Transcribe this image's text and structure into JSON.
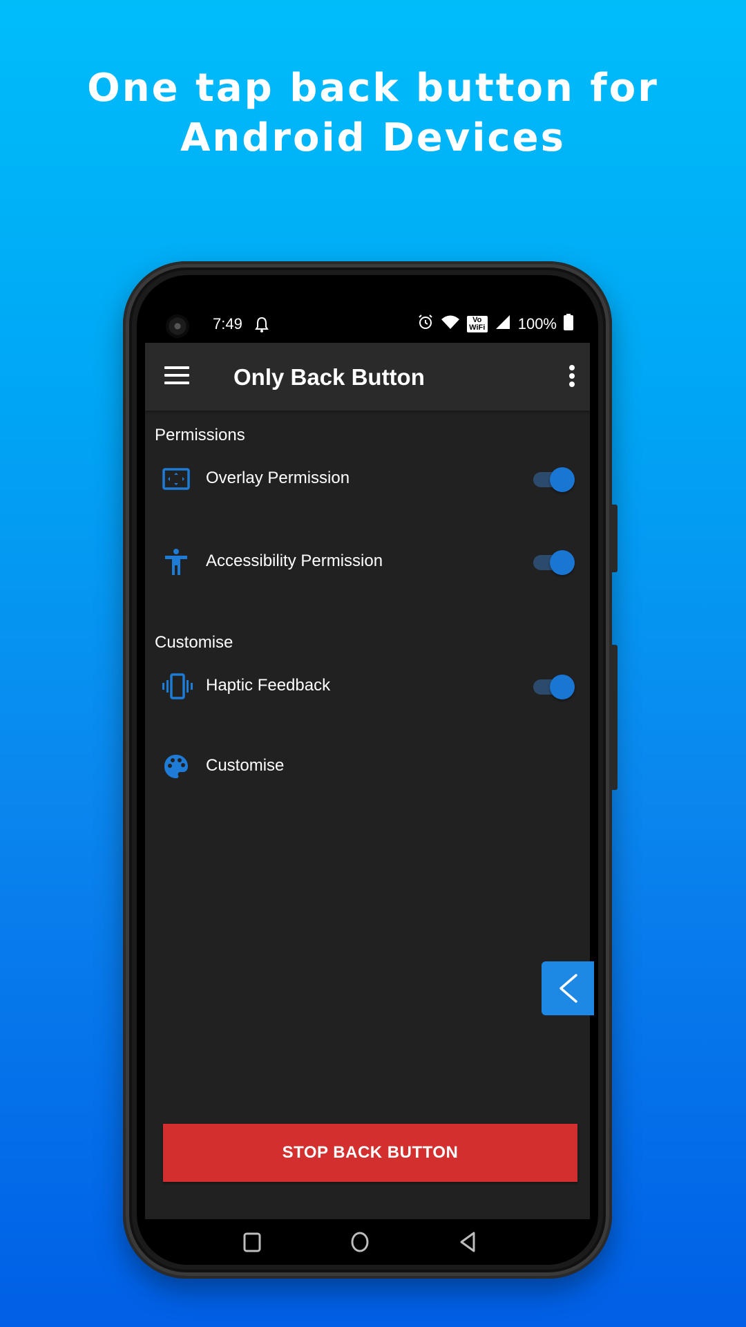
{
  "headline": {
    "line1": "One tap back button for",
    "line2": "Android Devices"
  },
  "status_bar": {
    "time": "7:49",
    "notification_icon": "bell-icon",
    "icons": [
      "alarm-icon",
      "wifi-icon",
      "vowifi-icon",
      "cellular-signal-icon",
      "battery-icon"
    ],
    "vowifi_top": "Vo",
    "vowifi_bottom": "WiFi",
    "battery_percent": "100%"
  },
  "app_bar": {
    "menu_icon": "hamburger-menu-icon",
    "title": "Only Back Button",
    "overflow_icon": "more-vert-icon"
  },
  "sections": [
    {
      "title": "Permissions",
      "items": [
        {
          "label": "Overlay Permission",
          "icon": "overlay-screen-icon",
          "toggle": true
        },
        {
          "label": "Accessibility Permission",
          "icon": "accessibility-icon",
          "toggle": true
        }
      ]
    },
    {
      "title": "Customise",
      "items": [
        {
          "label": "Haptic Feedback",
          "icon": "vibration-icon",
          "toggle": true
        },
        {
          "label": "Customise",
          "icon": "palette-icon",
          "toggle": null
        }
      ]
    }
  ],
  "floating_back": {
    "icon": "chevron-left-icon"
  },
  "stop_button": {
    "label": "STOP BACK BUTTON"
  },
  "nav_bar": {
    "buttons": [
      "recents-icon",
      "home-icon",
      "back-icon"
    ]
  },
  "colors": {
    "accent": "#1976d2",
    "stop": "#d32f2f",
    "app_bg": "#212121",
    "app_bar_bg": "#2a2a2a",
    "floating_back": "#1e88e5"
  }
}
